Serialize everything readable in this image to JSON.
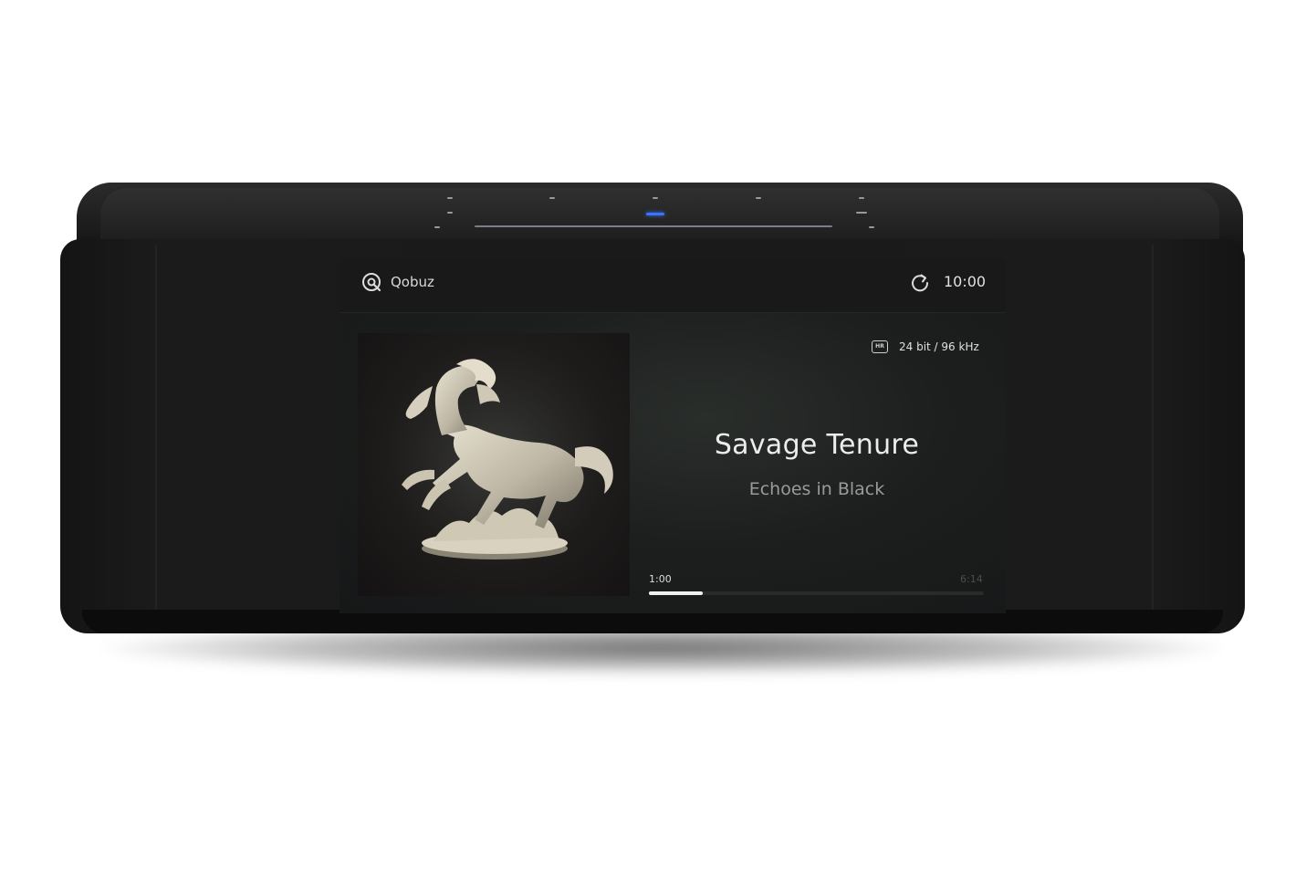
{
  "status_bar": {
    "source": "Qobuz",
    "source_icon": "qobuz-logo-icon",
    "refresh_icon": "refresh-icon",
    "clock": "10:00"
  },
  "now_playing": {
    "quality_badge": "HR",
    "quality": "24 bit / 96 kHz",
    "title": "Savage Tenure",
    "artist": "Echoes in Black",
    "elapsed": "1:00",
    "total": "6:14",
    "progress": 0.16
  },
  "device": {
    "power_led_color": "#3a73ff"
  }
}
